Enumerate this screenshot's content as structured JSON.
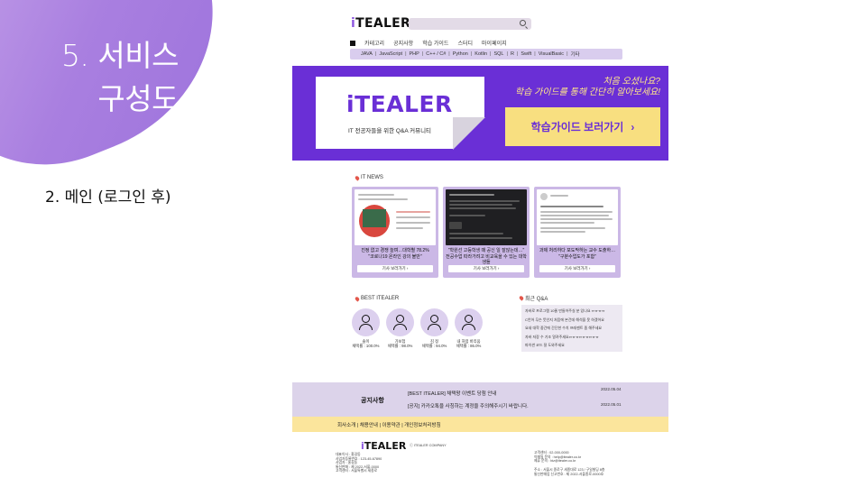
{
  "slide": {
    "title_line1": "5. 서비스",
    "title_line2": "구성도",
    "subtitle": "2. 메인 (로그인 후)",
    "accent": "#a97fe0"
  },
  "header": {
    "logo_i": "i",
    "logo_rest": "TEALER",
    "menu": [
      "카테고리",
      "공지사항",
      "학습 가이드",
      "스터디",
      "마이페이지"
    ],
    "languages": [
      "JAVA",
      "JavaScript",
      "PHP",
      "C++ / C#",
      "Python",
      "Kotlin",
      "SQL",
      "R",
      "Swift",
      "VisualBasic",
      "기타"
    ]
  },
  "banner": {
    "logo": "iTEALER",
    "tagline": "IT 전공자들을 위한 Q&A 커뮤니티",
    "copy_line1": "처음 오셨나요?",
    "copy_line2": "학습 가이드를 통해 간단히 알아보세요!",
    "button_label": "학습가이드 보러가기",
    "button_arrow": "›",
    "bg_color": "#6a2fd6",
    "button_color": "#f8df80"
  },
  "news": {
    "title": "IT NEWS",
    "cards": [
      {
        "caption_line1": "진정 없고 경쟁 늘며…대학별 78.2%",
        "caption_line2": "\"코로나19 온라인 강의 불만\"",
        "button": "기사 보러가기 ›"
      },
      {
        "caption_line1": "\"학원선 고등학생 때 공신 일 잘않는데…\"",
        "caption_line2": "전공수업 따라가려고 비교육을 수 있는 대학생들",
        "button": "기사 보러가기 ›"
      },
      {
        "caption_line1": "과제 처리하다 포도막하는 교수 도출하…",
        "caption_line2": "\"구분수업도가 포함\"",
        "button": "기사 보러가기 ›"
      }
    ]
  },
  "best": {
    "title": "BEST ITEALER",
    "users": [
      {
        "name": "솔이",
        "rate": "채택률 : 100.0%"
      },
      {
        "name": "가보첩",
        "rate": "채택률 : 98.0%"
      },
      {
        "name": "김 정",
        "rate": "채택률 : 94.0%"
      },
      {
        "name": "내 처럼 바리움",
        "rate": "채택률 : 86.0%"
      }
    ]
  },
  "qa": {
    "title": "최근 Q&A",
    "items": [
      "자바로 프로그램 10줄 만들어주실 분 있나요 ㅠㅠㅠㅠ",
      "C언어 무슨 뜻인지 처음에 본건데 해석을 못 하겠어요",
      "요새 대학 중간에 간단한 수치 프레젠트 좀 해주세요",
      "자바 저장 수 기조 알려주세요ㅠㅠㅠㅠㅠㅠㅠㅠㅠ",
      "파이썬 코드 잘 도와주세요"
    ]
  },
  "notice": {
    "label": "공지사항",
    "rows": [
      {
        "text": "[BEST ITEALER] 채택왕 이벤트 당첨 안내",
        "date": "2022.05.04"
      },
      {
        "text": "[공지] 카카오톡을 사칭하는 계정을 주의해주시기 바랍니다.",
        "date": "2022.05.01"
      }
    ]
  },
  "footer": {
    "links": "회사소개 | 채용안내 | 이용약관 | 개인정보처리방침",
    "logo_i": "i",
    "logo_rest": "TEALER",
    "company": "ⓒ ITEALER COMPANY",
    "left_lines": [
      "대표이사 : 홍길동",
      "사업자등록번호 : 123-45-67890",
      "사업자 : 홍길동",
      "통신판매 : 제 2022-서울-0000",
      "고객센터 : 서울특별시 세종로"
    ],
    "right_lines": [
      "고객센터 : 02-000-0000",
      "이메일 문의 : help@itealer.co.kr",
      "제휴 문의 : biz@itealer.co.kr"
    ],
    "right_lines2": [
      "주소 : 서울시 종로구 세종대로 123 / 구일빌딩 8층",
      "통신판매업 신고번호 : 제 2022-서울종로-0000호"
    ]
  }
}
